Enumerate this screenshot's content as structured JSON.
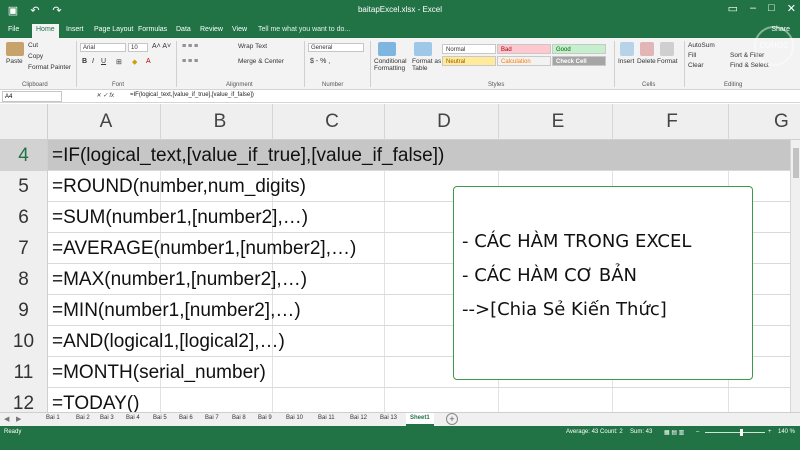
{
  "window": {
    "title": "baitapExcel.xlsx - Excel",
    "user": "Share"
  },
  "ribbon_tabs": [
    "File",
    "Home",
    "Insert",
    "Page Layout",
    "Formulas",
    "Data",
    "Review",
    "View"
  ],
  "tell_me": "Tell me what you want to do...",
  "share_label": "Share",
  "ribbon": {
    "clipboard": {
      "paste": "Paste",
      "cut": "Cut",
      "copy": "Copy",
      "format_painter": "Format Painter",
      "label": "Clipboard"
    },
    "font": {
      "name": "Arial",
      "size": "10",
      "label": "Font"
    },
    "alignment": {
      "wrap": "Wrap Text",
      "merge": "Merge & Center",
      "label": "Alignment"
    },
    "number": {
      "format": "General",
      "label": "Number"
    },
    "styles": {
      "conditional": "Conditional Formatting",
      "format_as_table": "Format as Table",
      "normal": "Normal",
      "bad": "Bad",
      "good": "Good",
      "neutral": "Neutral",
      "calculation": "Calculation",
      "check_cell": "Check Cell",
      "label": "Styles"
    },
    "cells": {
      "insert": "Insert",
      "delete": "Delete",
      "format": "Format",
      "label": "Cells"
    },
    "editing": {
      "autosum": "AutoSum",
      "fill": "Fill",
      "clear": "Clear",
      "sort": "Sort & Filter",
      "find": "Find & Select",
      "label": "Editing"
    }
  },
  "name_box": "A4",
  "formula": "=IF(logical_text,[value_if_true],[value_if_false])",
  "columns": [
    "A",
    "B",
    "C",
    "D",
    "E",
    "F",
    "G"
  ],
  "rows": [
    {
      "num": "4",
      "text": "=IF(logical_text,[value_if_true],[value_if_false])",
      "selected": true
    },
    {
      "num": "5",
      "text": "=ROUND(number,num_digits)"
    },
    {
      "num": "6",
      "text": "=SUM(number1,[number2],…)"
    },
    {
      "num": "7",
      "text": "=AVERAGE(number1,[number2],…)"
    },
    {
      "num": "8",
      "text": "=MAX(number1,[number2],…)"
    },
    {
      "num": "9",
      "text": "=MIN(number1,[number2],…)"
    },
    {
      "num": "10",
      "text": "=AND(logical1,[logical2],…)"
    },
    {
      "num": "11",
      "text": "=MONTH(serial_number)"
    },
    {
      "num": "12",
      "text": "=TODAY()"
    }
  ],
  "callout": {
    "line1": "- CÁC HÀM TRONG EXCEL",
    "line2": "- CÁC HÀM CƠ BẢN",
    "line3": " -->[Chia Sẻ Kiến Thức]"
  },
  "sheets": [
    "Bai 1",
    "Bai 2",
    "Bai 3",
    "Bai 4",
    "Bai 5",
    "Bai 6",
    "Bai 7",
    "Bai 8",
    "Bai 9",
    "Bai 10",
    "Bai 11",
    "Bai 12",
    "Bai 13",
    "Sheet1"
  ],
  "active_sheet": "Sheet1",
  "status": {
    "ready": "Ready",
    "average": "Average: 43",
    "count": "Count: 2",
    "sum": "Sum: 43",
    "zoom": "140 %"
  },
  "colors": {
    "excel_green": "#217346",
    "callout_border": "#3a9a4a"
  }
}
